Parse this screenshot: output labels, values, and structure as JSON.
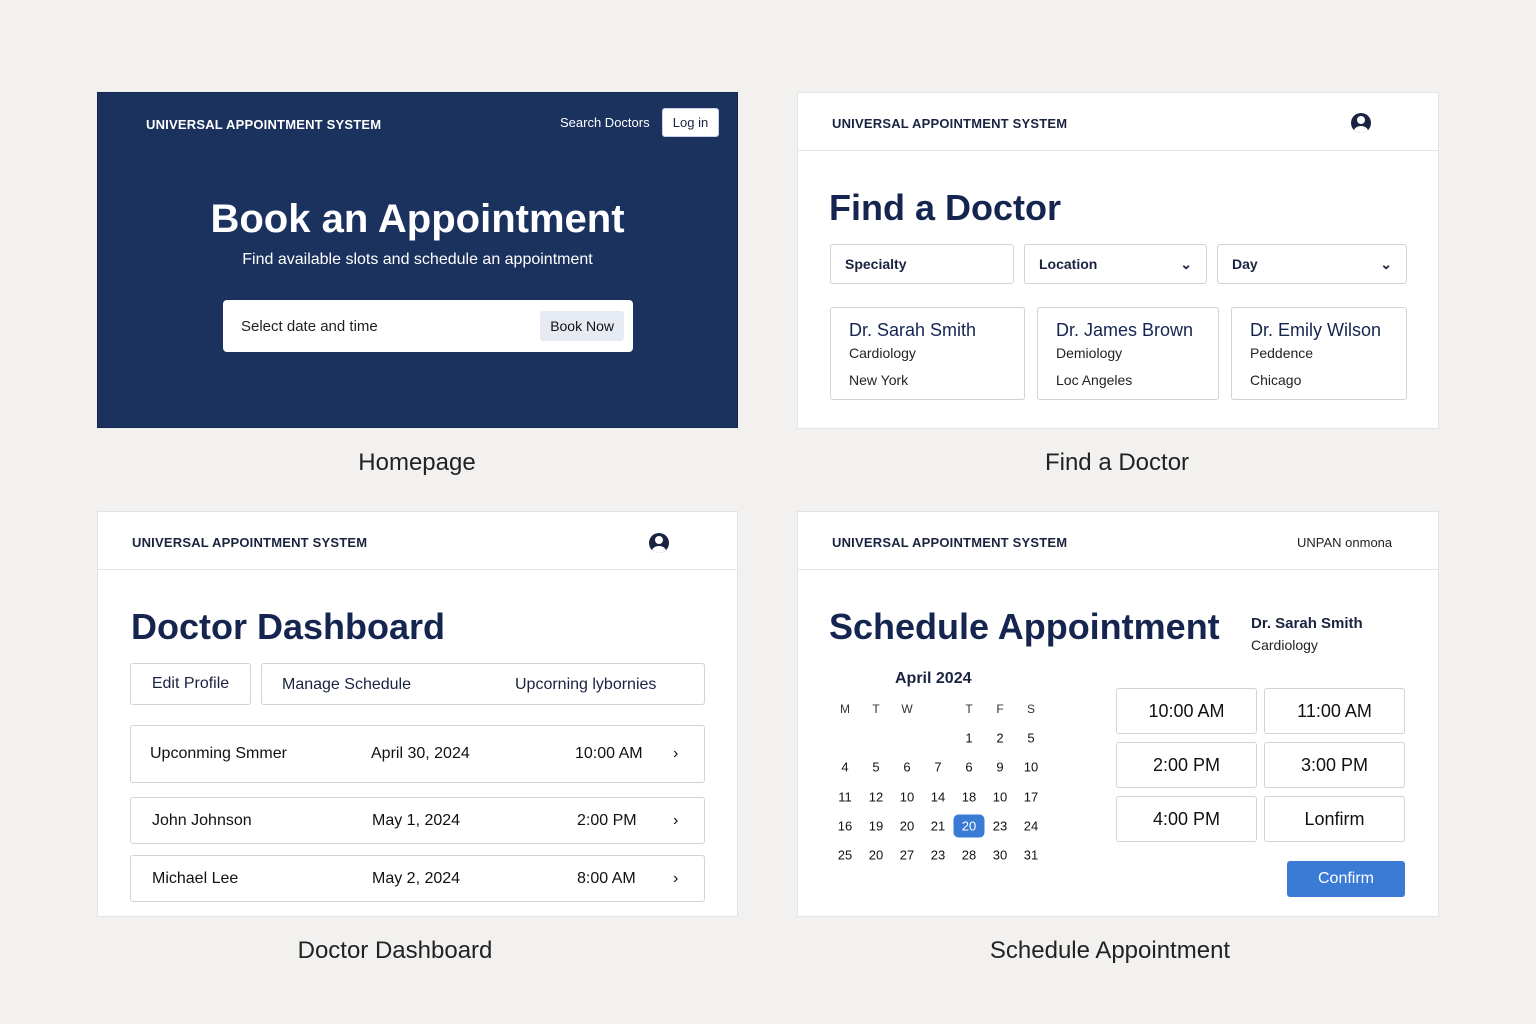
{
  "brand": "UNIVERSAL APPOINTMENT SYSTEM",
  "home": {
    "nav_search": "Search Doctors",
    "login": "Log in",
    "title": "Book an Appointment",
    "subtitle": "Find available slots and schedule an appointment",
    "input_placeholder": "Select date and time",
    "book_now": "Book Now",
    "caption": "Homepage",
    "bg": "#1b325f"
  },
  "find": {
    "title": "Find a Doctor",
    "filters": [
      "Specialty",
      "Location",
      "Day"
    ],
    "doctors": [
      {
        "name": "Dr. Sarah Smith",
        "specialty": "Cardiology",
        "city": "New York"
      },
      {
        "name": "Dr. James Brown",
        "specialty": "Demiology",
        "city": "Loc Angeles"
      },
      {
        "name": "Dr. Emily Wilson",
        "specialty": "Peddence",
        "city": "Chicago"
      }
    ],
    "caption": "Find a Doctor"
  },
  "dash": {
    "title": "Doctor Dashboard",
    "edit": "Edit Profile",
    "manage": "Manage Schedule",
    "upcoming": "Upcorning lybornies",
    "rows": [
      {
        "name": "Upconming Smmer",
        "date": "April 30, 2024",
        "time": "10:00 AM"
      },
      {
        "name": "John Johnson",
        "date": "May 1, 2024",
        "time": "2:00 PM"
      },
      {
        "name": "Michael Lee",
        "date": "May 2, 2024",
        "time": "8:00 AM"
      }
    ],
    "caption": "Doctor Dashboard"
  },
  "sched": {
    "nav_right": "UNPAN onmona",
    "title": "Schedule Appointment",
    "doctor": "Dr. Sarah Smith",
    "specialty": "Cardiology",
    "month": "April 2024",
    "weekdays": [
      "M",
      "T",
      "W",
      "",
      "T",
      "F",
      "S"
    ],
    "weeks": [
      [
        "",
        "",
        "",
        "",
        "1",
        "2",
        "5"
      ],
      [
        "4",
        "5",
        "6",
        "7",
        "6",
        "9",
        "10"
      ],
      [
        "11",
        "12",
        "10",
        "14",
        "18",
        "10",
        "17"
      ],
      [
        "16",
        "19",
        "20",
        "21",
        "20",
        "23",
        "24"
      ],
      [
        "25",
        "20",
        "27",
        "23",
        "28",
        "30",
        "31"
      ]
    ],
    "selected": "20",
    "selected_color": "#3a7bd5",
    "slots": [
      "10:00 AM",
      "11:00 AM",
      "2:00 PM",
      "3:00 PM",
      "4:00 PM",
      "Lonfirm"
    ],
    "confirm": "Confirm",
    "caption": "Schedule Appointment"
  }
}
